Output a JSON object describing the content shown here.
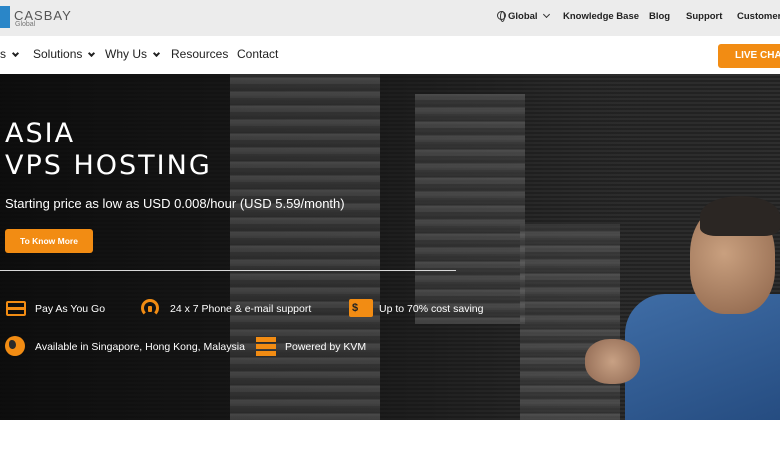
{
  "brand": {
    "name": "CASBAY",
    "sub": "Global"
  },
  "utility_nav": {
    "region": "Global",
    "links": [
      "Knowledge Base",
      "Blog",
      "Support",
      "Customer"
    ]
  },
  "main_nav": {
    "items": [
      "s",
      "Solutions",
      "Why Us",
      "Resources",
      "Contact"
    ],
    "live_chat": "LIVE CHA"
  },
  "hero": {
    "title_line1": "ASIA",
    "title_line2": "VPS HOSTING",
    "subtitle": "Starting price as low as USD 0.008/hour (USD 5.59/month)",
    "cta": "To Know More"
  },
  "features": [
    {
      "icon": "credit-card-icon",
      "label": "Pay As You Go"
    },
    {
      "icon": "headset-icon",
      "label": "24 x 7 Phone & e-mail support"
    },
    {
      "icon": "dollar-icon",
      "label": "Up to 70% cost saving"
    },
    {
      "icon": "globe-icon",
      "label": "Available in Singapore, Hong Kong, Malaysia"
    },
    {
      "icon": "server-icon",
      "label": "Powered by KVM"
    }
  ],
  "colors": {
    "accent": "#f28c13",
    "topbar": "#ececec",
    "logo": "#2a86c8"
  }
}
